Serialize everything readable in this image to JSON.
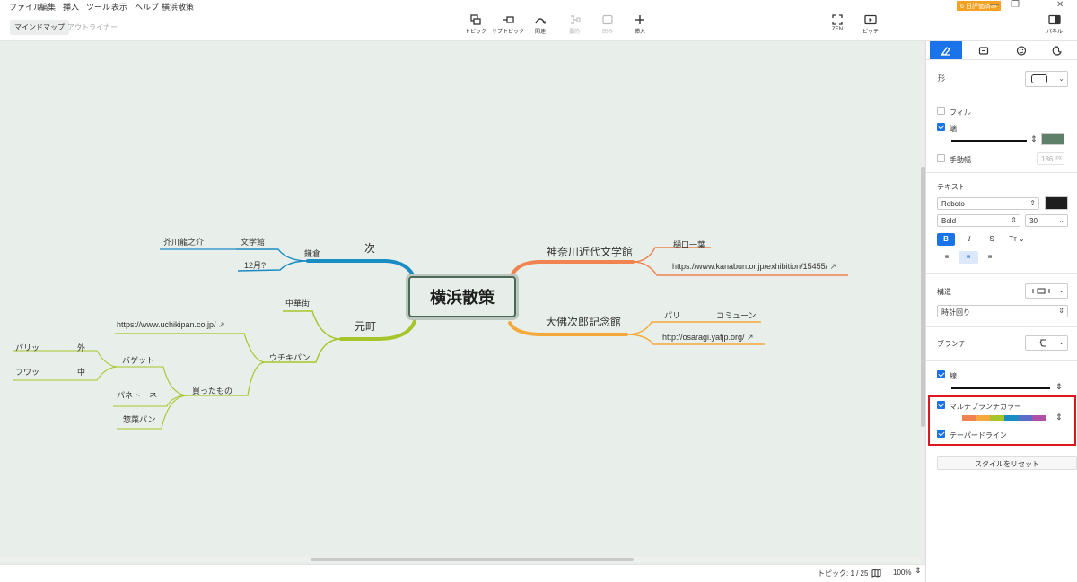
{
  "menu": {
    "items": [
      "ファイル",
      "編集",
      "挿入",
      "ツール",
      "表示",
      "ヘルプ"
    ],
    "doc_title": "横浜散策",
    "trial_badge": "6 日評価済み",
    "window_controls": [
      "—",
      "❐",
      "✕"
    ]
  },
  "toolbar": {
    "view_tabs": [
      "マインドマップ",
      "アウトライナー"
    ],
    "buttons": [
      {
        "label": "トピック",
        "icon": "topic-icon",
        "enabled": true
      },
      {
        "label": "サブトピック",
        "icon": "subtopic-icon",
        "enabled": true
      },
      {
        "label": "関連",
        "icon": "relationship-icon",
        "enabled": true
      },
      {
        "label": "要約",
        "icon": "summary-icon",
        "enabled": false
      },
      {
        "label": "囲み",
        "icon": "boundary-icon",
        "enabled": false
      },
      {
        "label": "挿入",
        "icon": "plus-icon",
        "enabled": true
      }
    ],
    "right_buttons": [
      {
        "label": "ZEN",
        "icon": "zen-icon"
      },
      {
        "label": "ピッチ",
        "icon": "pitch-icon"
      },
      {
        "label": "パネル",
        "icon": "panel-icon"
      }
    ]
  },
  "mindmap": {
    "central": "横浜散策",
    "topics": [
      {
        "label": "次",
        "color": "#1a8cc4"
      },
      {
        "label": "元町",
        "color": "#a6c52a"
      },
      {
        "label": "神奈川近代文学館",
        "color": "#f0834f"
      },
      {
        "label": "大佛次郎記念館",
        "color": "#f5a93a"
      }
    ],
    "subtopics": {
      "kamakura": "鎌倉",
      "bungakukan": "文学館",
      "akutagawa": "芥川龍之介",
      "month": "12月?",
      "chukagai": "中華街",
      "uchikipan": "ウチキパン",
      "uchikipan_url": "https://www.uchikipan.co.jp/",
      "katta": "買ったもの",
      "baguette": "バゲット",
      "paripari": "パリッ",
      "soto": "外",
      "fuwa": "フワッ",
      "naka": "中",
      "panettone": "パネトーネ",
      "souzai": "惣菜パン",
      "higuchi": "樋口一葉",
      "kanabun_url": "https://www.kanabun.or.jp/exhibition/15455/",
      "pari": "パリ",
      "commune": "コミューン",
      "osaragi_url": "http://osaragi.yafjp.org/"
    }
  },
  "statusbar": {
    "topics": "トピック: 1 / 25",
    "zoom": "100%"
  },
  "panel": {
    "tabs": [
      "style-icon",
      "map-icon",
      "emoji-icon",
      "theme-icon"
    ],
    "shape_label": "形",
    "fill_label": "フィル",
    "border_label": "端",
    "border_color": "#5e7f69",
    "manual_width_label": "手動幅",
    "manual_width_value": "186",
    "manual_width_unit": "PX",
    "text_label": "テキスト",
    "font": "Roboto",
    "font_color": "#1e1e1e",
    "weight": "Bold",
    "size": "30",
    "structure_label": "構造",
    "structure_value": "時計回り",
    "branch_label": "ブランチ",
    "line_label": "線",
    "multi_branch_label": "マルチブランチカラー",
    "tapered_label": "テーパードライン",
    "reset_label": "スタイルをリセット",
    "accent": "#1a73e8",
    "highlight": "#e0161f",
    "rainbow": [
      "#f0834f",
      "#f5a93a",
      "#a6c52a",
      "#1a8cc4",
      "#5b6cc9",
      "#b04fa8"
    ]
  }
}
